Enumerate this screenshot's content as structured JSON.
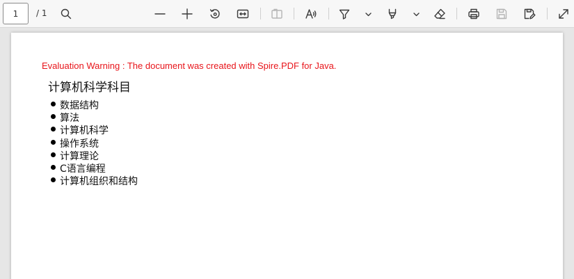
{
  "toolbar": {
    "page_number": "1",
    "page_total": "/ 1",
    "icons": [
      "search-icon",
      "zoom-out-icon",
      "zoom-in-icon",
      "rotate-icon",
      "fit-width-icon",
      "two-page-icon",
      "read-aloud-icon",
      "highlight-icon",
      "chevron-down-icon",
      "draw-icon",
      "chevron-down-icon",
      "eraser-icon",
      "print-icon",
      "save-icon",
      "save-as-icon",
      "fullscreen-icon"
    ]
  },
  "document": {
    "warning": "Evaluation Warning : The document was created with Spire.PDF for Java.",
    "heading": "计算机科学科目",
    "items": [
      "数据结构",
      "算法",
      "计算机科学",
      "操作系统",
      "计算理论",
      "C语言编程",
      "计算机组织和结构"
    ]
  },
  "colors": {
    "warning": "#e8141a",
    "toolbar_bg": "#f7f7f7",
    "canvas_bg": "#e6e6e6",
    "page_bg": "#ffffff"
  }
}
